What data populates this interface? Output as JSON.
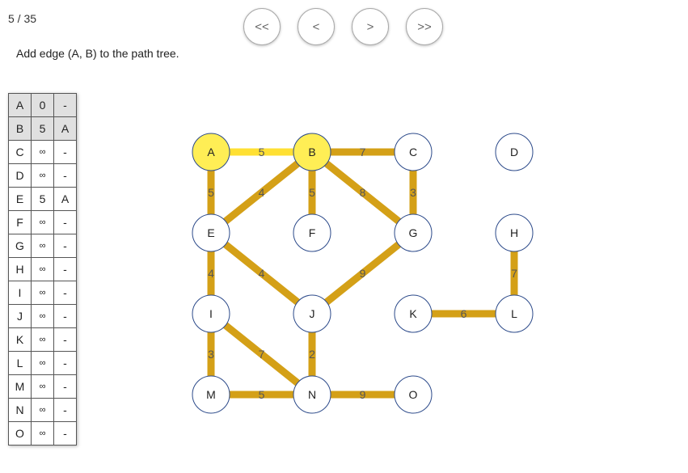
{
  "header": {
    "step_counter": "5 / 35",
    "message": "Add edge (A, B) to the path tree."
  },
  "nav": {
    "first": "<<",
    "prev": "<",
    "next": ">",
    "last": ">>"
  },
  "distance_table": [
    {
      "node": "A",
      "dist": "0",
      "prev": "-",
      "done": true
    },
    {
      "node": "B",
      "dist": "5",
      "prev": "A",
      "done": true
    },
    {
      "node": "C",
      "dist": "∞",
      "prev": "-",
      "done": false
    },
    {
      "node": "D",
      "dist": "∞",
      "prev": "-",
      "done": false
    },
    {
      "node": "E",
      "dist": "5",
      "prev": "A",
      "done": false
    },
    {
      "node": "F",
      "dist": "∞",
      "prev": "-",
      "done": false
    },
    {
      "node": "G",
      "dist": "∞",
      "prev": "-",
      "done": false
    },
    {
      "node": "H",
      "dist": "∞",
      "prev": "-",
      "done": false
    },
    {
      "node": "I",
      "dist": "∞",
      "prev": "-",
      "done": false
    },
    {
      "node": "J",
      "dist": "∞",
      "prev": "-",
      "done": false
    },
    {
      "node": "K",
      "dist": "∞",
      "prev": "-",
      "done": false
    },
    {
      "node": "L",
      "dist": "∞",
      "prev": "-",
      "done": false
    },
    {
      "node": "M",
      "dist": "∞",
      "prev": "-",
      "done": false
    },
    {
      "node": "N",
      "dist": "∞",
      "prev": "-",
      "done": false
    },
    {
      "node": "O",
      "dist": "∞",
      "prev": "-",
      "done": false
    }
  ],
  "graph": {
    "colors": {
      "edge": "#d4a017",
      "edge_highlight": "#ffe033",
      "node_highlight": "#ffee55",
      "node_fill": "#ffffff",
      "node_stroke": "#2c4a8a"
    },
    "nodes": [
      {
        "id": "A",
        "highlight": true
      },
      {
        "id": "B",
        "highlight": true
      },
      {
        "id": "C",
        "highlight": false
      },
      {
        "id": "D",
        "highlight": false
      },
      {
        "id": "E",
        "highlight": false
      },
      {
        "id": "F",
        "highlight": false
      },
      {
        "id": "G",
        "highlight": false
      },
      {
        "id": "H",
        "highlight": false
      },
      {
        "id": "I",
        "highlight": false
      },
      {
        "id": "J",
        "highlight": false
      },
      {
        "id": "K",
        "highlight": false
      },
      {
        "id": "L",
        "highlight": false
      },
      {
        "id": "M",
        "highlight": false
      },
      {
        "id": "N",
        "highlight": false
      },
      {
        "id": "O",
        "highlight": false
      }
    ],
    "edges": [
      {
        "from": "A",
        "to": "B",
        "weight": "5",
        "highlight": true
      },
      {
        "from": "B",
        "to": "C",
        "weight": "7",
        "highlight": false
      },
      {
        "from": "A",
        "to": "E",
        "weight": "5",
        "highlight": false
      },
      {
        "from": "B",
        "to": "E",
        "weight": "4",
        "highlight": false
      },
      {
        "from": "B",
        "to": "F",
        "weight": "5",
        "highlight": false
      },
      {
        "from": "B",
        "to": "G",
        "weight": "8",
        "highlight": false
      },
      {
        "from": "C",
        "to": "G",
        "weight": "3",
        "highlight": false
      },
      {
        "from": "E",
        "to": "I",
        "weight": "4",
        "highlight": false
      },
      {
        "from": "E",
        "to": "J",
        "weight": "4",
        "highlight": false
      },
      {
        "from": "G",
        "to": "J",
        "weight": "9",
        "highlight": false
      },
      {
        "from": "H",
        "to": "L",
        "weight": "7",
        "highlight": false
      },
      {
        "from": "K",
        "to": "L",
        "weight": "6",
        "highlight": false
      },
      {
        "from": "I",
        "to": "M",
        "weight": "3",
        "highlight": false
      },
      {
        "from": "I",
        "to": "N",
        "weight": "7",
        "highlight": false
      },
      {
        "from": "J",
        "to": "N",
        "weight": "2",
        "highlight": false
      },
      {
        "from": "M",
        "to": "N",
        "weight": "5",
        "highlight": false
      },
      {
        "from": "N",
        "to": "O",
        "weight": "9",
        "highlight": false
      }
    ]
  }
}
